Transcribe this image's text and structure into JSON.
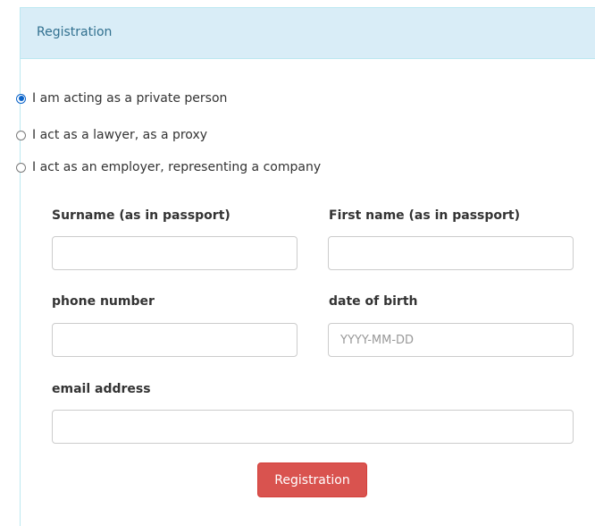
{
  "panel": {
    "title": "Registration"
  },
  "account_type": {
    "options": [
      {
        "label": "I am acting as a private person",
        "checked": true
      },
      {
        "label": "I act as a lawyer, as a proxy",
        "checked": false
      },
      {
        "label": "I act as an employer, representing a company",
        "checked": false
      }
    ]
  },
  "form": {
    "surname": {
      "label": "Surname (as in passport)",
      "value": "",
      "placeholder": ""
    },
    "first_name": {
      "label": "First name (as in passport)",
      "value": "",
      "placeholder": ""
    },
    "phone": {
      "label": "phone number",
      "value": "",
      "placeholder": ""
    },
    "dob": {
      "label": "date of birth",
      "value": "",
      "placeholder": "YYYY-MM-DD"
    },
    "email": {
      "label": "email address",
      "value": "",
      "placeholder": ""
    },
    "submit_label": "Registration"
  },
  "colors": {
    "panel_heading_bg": "#d9edf7",
    "panel_title": "#31708f",
    "button_bg": "#d9534f",
    "radio_checked": "#0a63c9"
  }
}
